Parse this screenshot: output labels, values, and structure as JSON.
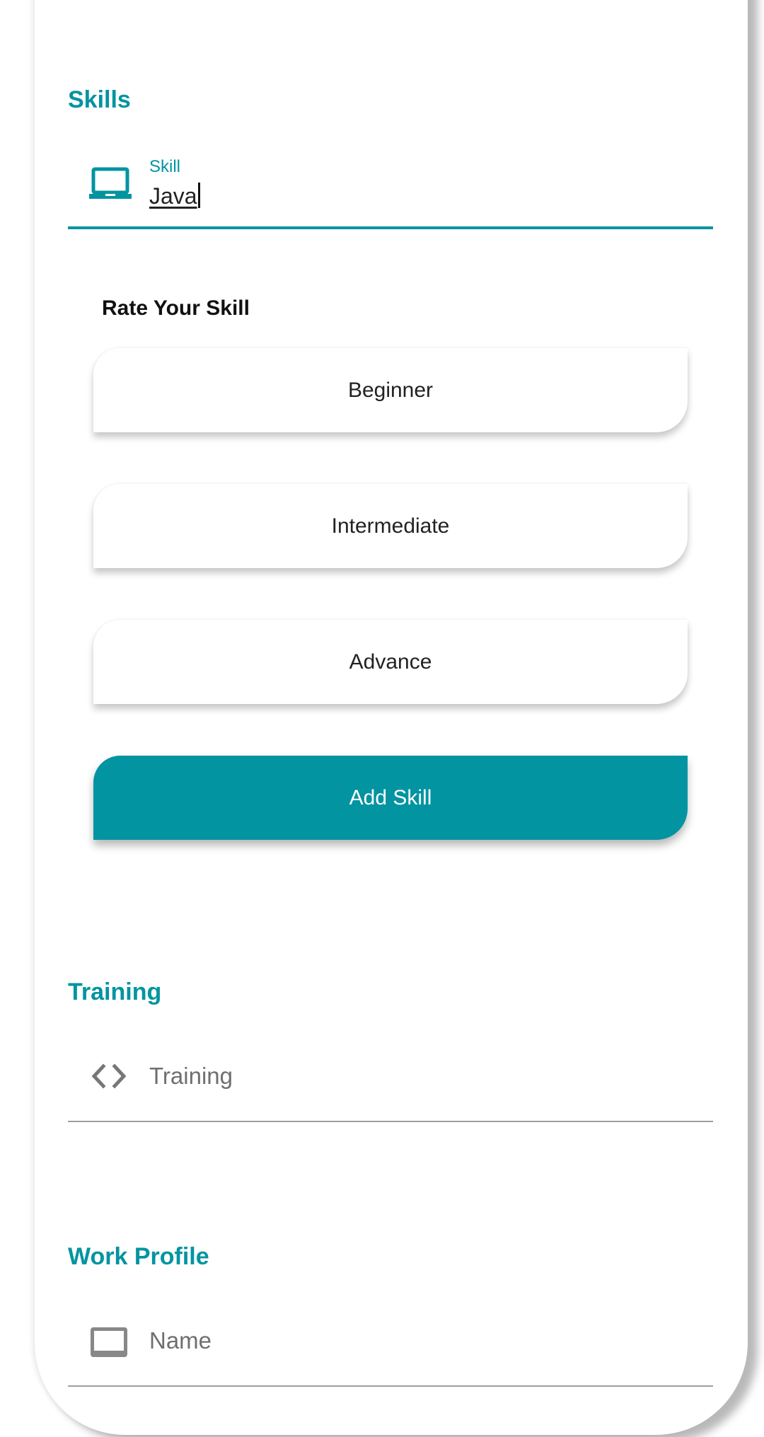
{
  "colors": {
    "accent": "#0294a1",
    "muted_text": "#6f6f6f",
    "divider": "#9e9e9e"
  },
  "skills": {
    "section_title": "Skills",
    "skill_field": {
      "icon": "laptop-icon",
      "label": "Skill",
      "value": "Java"
    },
    "rate_title": "Rate Your Skill",
    "levels": [
      {
        "label": "Beginner"
      },
      {
        "label": "Intermediate"
      },
      {
        "label": "Advance"
      }
    ],
    "add_button": "Add Skill"
  },
  "training": {
    "section_title": "Training",
    "field": {
      "icon": "code-icon",
      "placeholder": "Training"
    }
  },
  "work_profile": {
    "section_title": "Work Profile",
    "field": {
      "icon": "monitor-icon",
      "placeholder": "Name"
    }
  }
}
